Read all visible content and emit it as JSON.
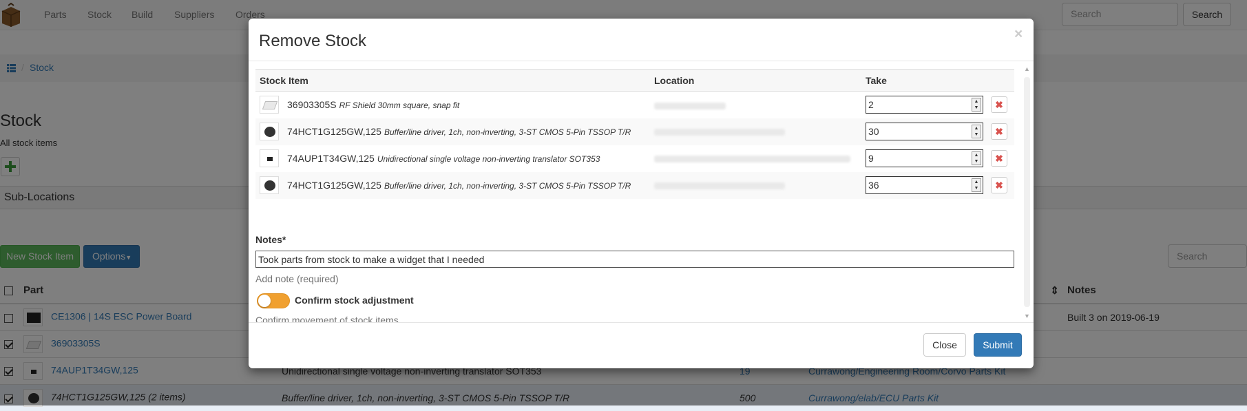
{
  "navbar": {
    "items": [
      "Parts",
      "Stock",
      "Build",
      "Suppliers",
      "Orders"
    ],
    "search_placeholder": "Search",
    "search_button": "Search"
  },
  "breadcrumb": {
    "link": "Stock",
    "separator": "/"
  },
  "page": {
    "title": "Stock",
    "subtitle": "All stock items",
    "sub_locations": "Sub-Locations",
    "new_stock_button": "New Stock Item",
    "options_button": "Options",
    "table_search_placeholder": "Search"
  },
  "bg_table": {
    "headers": {
      "part": "Part",
      "notes": "Notes"
    },
    "rows": [
      {
        "part": "CE1306 | 14S ESC Power Board",
        "desc": "",
        "qty": "",
        "location": "",
        "notes": "Built 3 on 2019-06-19",
        "checked": false
      },
      {
        "part": "36903305S",
        "desc": "",
        "qty": "",
        "location": "",
        "notes": "",
        "checked": true
      },
      {
        "part": "74AUP1T34GW,125",
        "desc": "Unidirectional single voltage non-inverting translator SOT353",
        "qty": "19",
        "location": "Currawong/Engineering Room/Corvo Parts Kit",
        "notes": "",
        "checked": true
      },
      {
        "part": "74HCT1G125GW,125 (2 items)",
        "desc": "Buffer/line driver, 1ch, non-inverting, 3-ST CMOS 5-Pin TSSOP T/R",
        "qty": "500",
        "location": "Currawong/elab/ECU Parts Kit",
        "notes": "",
        "checked": true
      }
    ]
  },
  "modal": {
    "title": "Remove Stock",
    "close_x": "×",
    "columns": {
      "item": "Stock Item",
      "location": "Location",
      "take": "Take"
    },
    "rows": [
      {
        "part": "36903305S",
        "desc": "RF Shield 30mm square, snap fit",
        "take": "2"
      },
      {
        "part": "74HCT1G125GW,125",
        "desc": "Buffer/line driver, 1ch, non-inverting, 3-ST CMOS 5-Pin TSSOP T/R",
        "take": "30"
      },
      {
        "part": "74AUP1T34GW,125",
        "desc": "Unidirectional single voltage non-inverting translator SOT353",
        "take": "9"
      },
      {
        "part": "74HCT1G125GW,125",
        "desc": "Buffer/line driver, 1ch, non-inverting, 3-ST CMOS 5-Pin TSSOP T/R",
        "take": "36"
      }
    ],
    "notes_label": "Notes*",
    "notes_value": "Took parts from stock to make a widget that I needed",
    "notes_help": "Add note (required)",
    "confirm_label": "Confirm stock adjustment",
    "confirm_help": "Confirm movement of stock items",
    "close_button": "Close",
    "submit_button": "Submit"
  },
  "colors": {
    "accent": "#337ab7",
    "success": "#5cb85c",
    "toggle": "#f0a030",
    "danger": "#d9534f"
  }
}
